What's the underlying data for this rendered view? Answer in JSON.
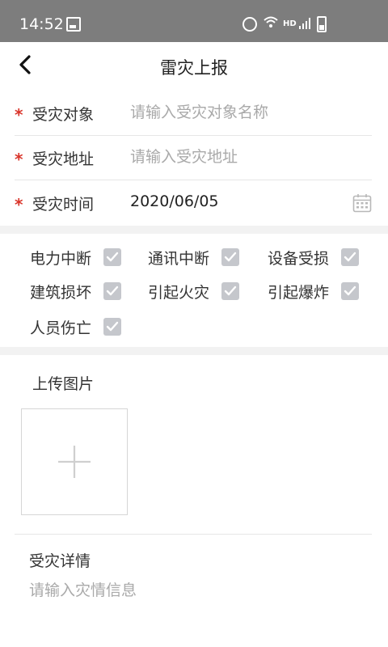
{
  "status_bar": {
    "time": "14:52",
    "network_label": "HD"
  },
  "header": {
    "title": "雷灾上报"
  },
  "form": {
    "required_mark": "*",
    "target": {
      "label": "受灾对象",
      "placeholder": "请输入受灾对象名称",
      "value": ""
    },
    "address": {
      "label": "受灾地址",
      "placeholder": "请输入受灾地址",
      "value": ""
    },
    "time": {
      "label": "受灾时间",
      "value": "2020/06/05"
    }
  },
  "damage_types": [
    {
      "label": "电力中断",
      "checked": true
    },
    {
      "label": "通讯中断",
      "checked": true
    },
    {
      "label": "设备受损",
      "checked": true
    },
    {
      "label": "建筑损坏",
      "checked": true
    },
    {
      "label": "引起火灾",
      "checked": true
    },
    {
      "label": "引起爆炸",
      "checked": true
    },
    {
      "label": "人员伤亡",
      "checked": true
    }
  ],
  "upload": {
    "label": "上传图片"
  },
  "details": {
    "label": "受灾详情",
    "placeholder": "请输入灾情信息"
  },
  "colors": {
    "status_bar_bg": "#7d7d7d",
    "required": "#d9352b",
    "checkbox": "#c5c7cc",
    "placeholder": "#a9a9a9"
  }
}
